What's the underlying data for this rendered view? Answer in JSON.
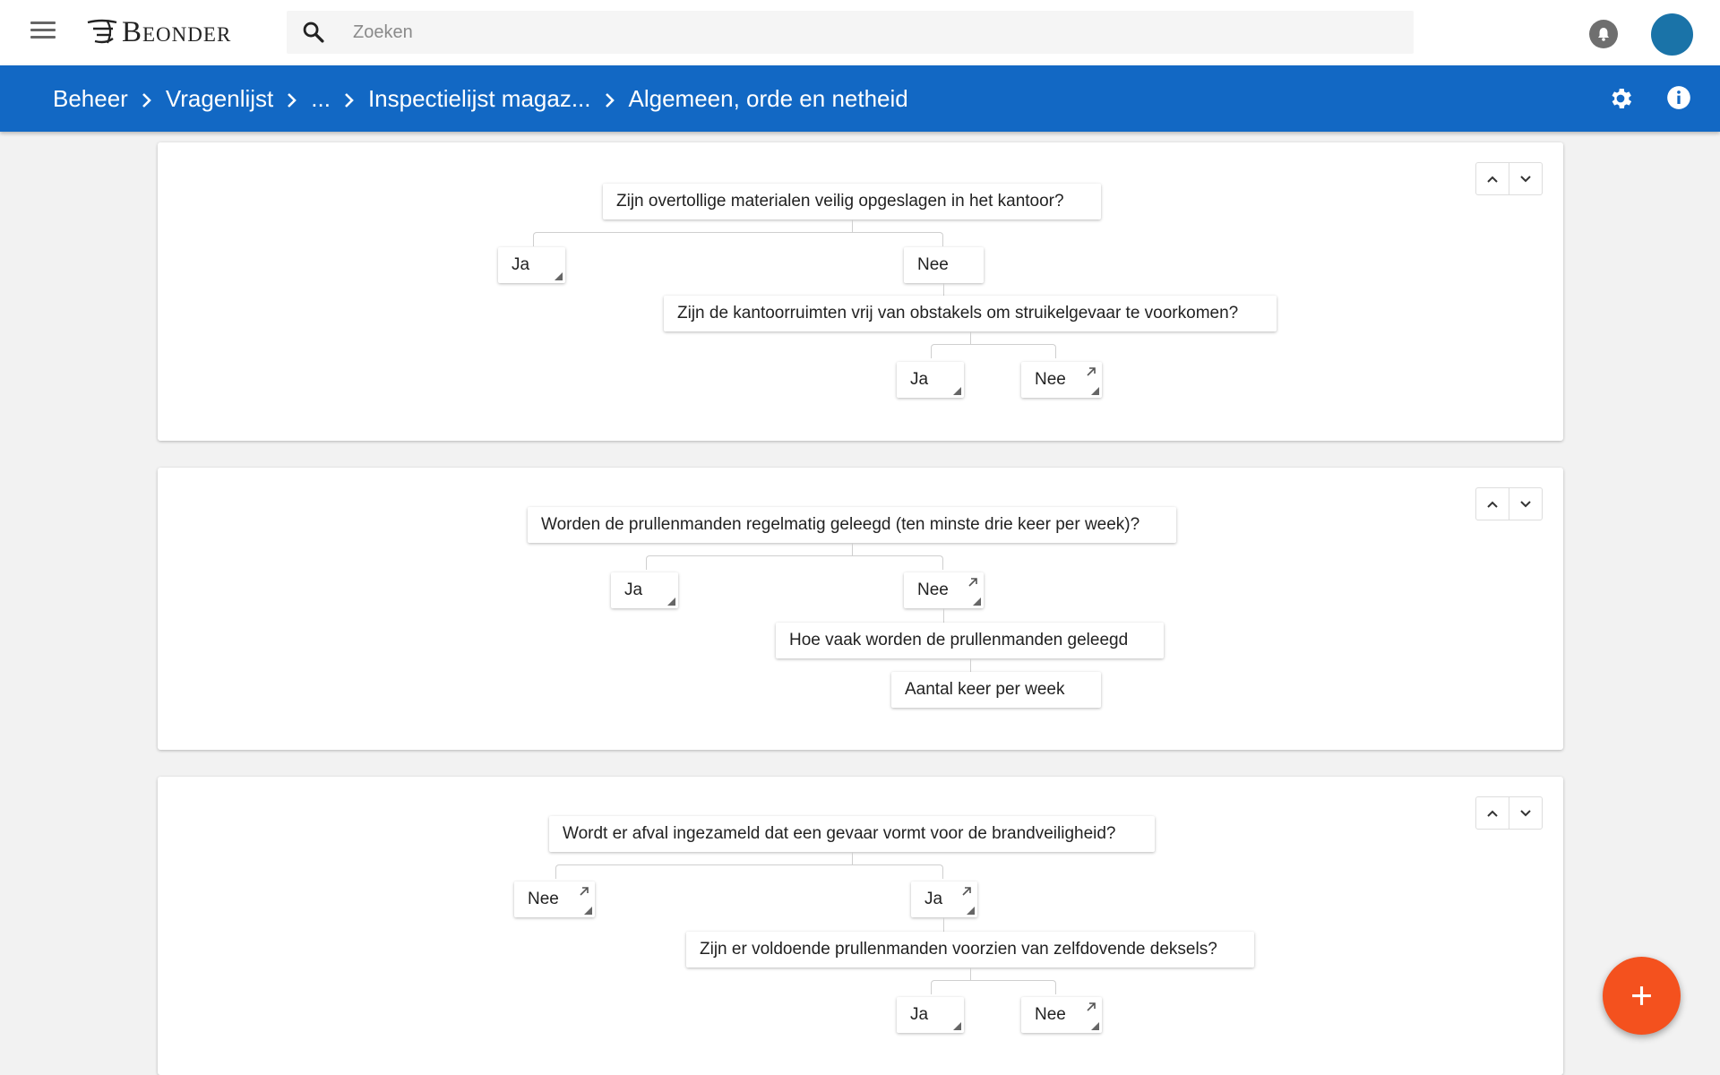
{
  "header": {
    "brand": "Beonder",
    "search_placeholder": "Zoeken",
    "colors": {
      "bar": "#1268c4",
      "fab": "#f4511e",
      "avatar": "#1a73a8"
    }
  },
  "breadcrumb": {
    "items": [
      "Beheer",
      "Vragenlijst",
      "...",
      "Inspectielijst magaz...",
      "Algemeen, orde en netheid"
    ]
  },
  "cards": [
    {
      "question": "Zijn overtollige materialen veilig opgeslagen in het kantoor?",
      "answers": [
        "Ja",
        "Nee"
      ],
      "sub_question": "Zijn de kantoorruimten vrij van obstakels om struikelgevaar te voorkomen?",
      "sub_answers": [
        "Ja",
        "Nee"
      ]
    },
    {
      "question": "Worden de prullenmanden regelmatig geleegd (ten minste drie keer per week)?",
      "answers": [
        "Ja",
        "Nee"
      ],
      "sub_question": "Hoe vaak worden de prullenmanden geleegd",
      "sub_answer": "Aantal keer per week"
    },
    {
      "question": "Wordt er afval ingezameld dat een gevaar vormt voor de brandveiligheid?",
      "answers": [
        "Nee",
        "Ja"
      ],
      "sub_question": "Zijn er voldoende prullenmanden voorzien van zelfdovende deksels?",
      "sub_answers": [
        "Ja",
        "Nee"
      ]
    }
  ],
  "icons": {
    "menu": "menu-icon",
    "search": "search-icon",
    "notifications": "bell-icon",
    "settings": "gear-icon",
    "info": "info-icon",
    "move_up": "chevron-up-icon",
    "move_down": "chevron-down-icon",
    "jump": "arrow-up-right-icon",
    "add": "plus-icon"
  }
}
